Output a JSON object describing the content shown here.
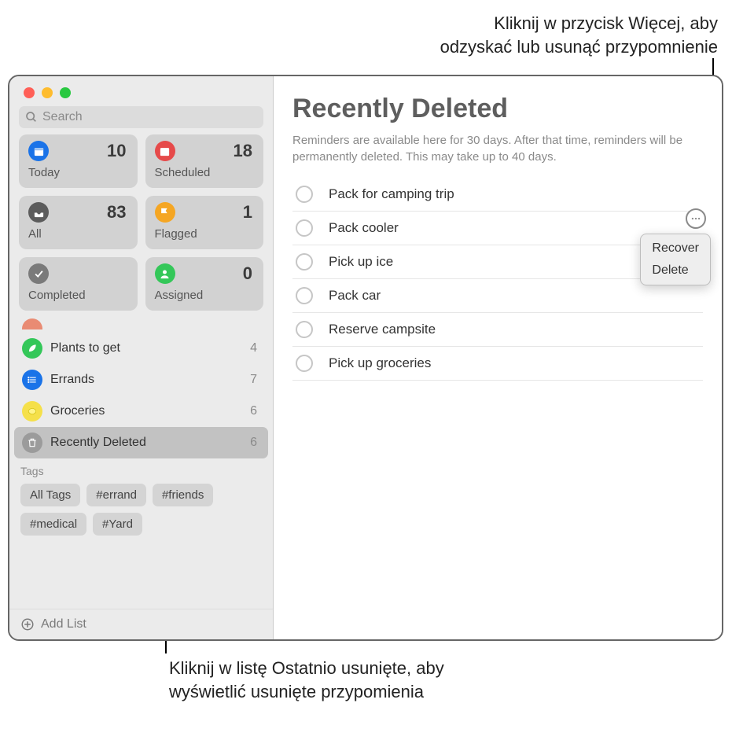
{
  "callouts": {
    "top": "Kliknij w przycisk Więcej, aby\nodzyskać lub usunąć przypomnienie",
    "bottom": "Kliknij w listę Ostatnio usunięte, aby wyświetlić usunięte przypomienia"
  },
  "search": {
    "placeholder": "Search"
  },
  "smart_lists": [
    {
      "label": "Today",
      "count": 10,
      "color": "#1a73e8",
      "icon": "calendar"
    },
    {
      "label": "Scheduled",
      "count": 18,
      "color": "#e64a4a",
      "icon": "calendar-lines"
    },
    {
      "label": "All",
      "count": 83,
      "color": "#5c5c5c",
      "icon": "tray"
    },
    {
      "label": "Flagged",
      "count": 1,
      "color": "#f5a623",
      "icon": "flag"
    },
    {
      "label": "Completed",
      "count": "",
      "color": "#7a7a7a",
      "icon": "check"
    },
    {
      "label": "Assigned",
      "count": 0,
      "color": "#34c759",
      "icon": "person"
    }
  ],
  "user_lists": [
    {
      "name": "Plants to get",
      "count": 4,
      "color": "#34c759",
      "icon": "leaf",
      "selected": false
    },
    {
      "name": "Errands",
      "count": 7,
      "color": "#1a73e8",
      "icon": "list",
      "selected": false
    },
    {
      "name": "Groceries",
      "count": 6,
      "color": "#f5e04a",
      "icon": "lemon",
      "selected": false
    },
    {
      "name": "Recently Deleted",
      "count": 6,
      "color": "#9b9b9b",
      "icon": "trash",
      "selected": true
    }
  ],
  "tags": {
    "title": "Tags",
    "items": [
      "All Tags",
      "#errand",
      "#friends",
      "#medical",
      "#Yard"
    ]
  },
  "add_list_label": "Add List",
  "main": {
    "title": "Recently Deleted",
    "subtitle": "Reminders are available here for 30 days. After that time, reminders will be permanently deleted. This may take up to 40 days.",
    "reminders": [
      "Pack for camping trip",
      "Pack cooler",
      "Pick up ice",
      "Pack car",
      "Reserve campsite",
      "Pick up groceries"
    ]
  },
  "popover": {
    "recover": "Recover",
    "delete": "Delete"
  }
}
